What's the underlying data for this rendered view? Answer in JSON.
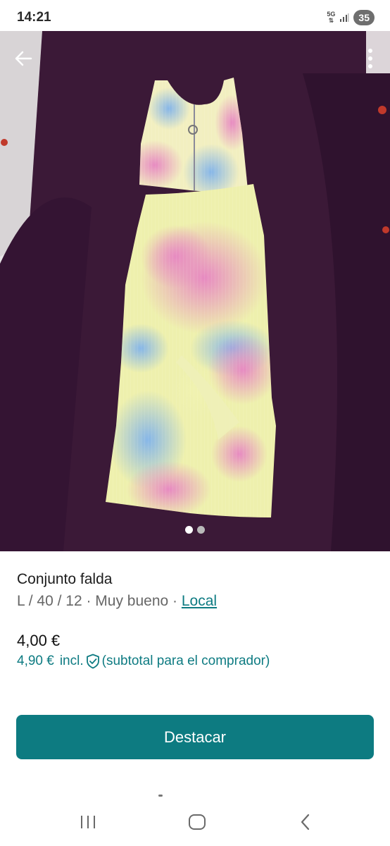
{
  "status_bar": {
    "time": "14:21",
    "network": "5G",
    "battery": "35",
    "icons": [
      "network-5g-icon",
      "signal-icon",
      "battery-icon"
    ]
  },
  "gallery": {
    "image": "tie-dye-set-photo",
    "image_count": 2,
    "active_index": 0,
    "icons": [
      "back-arrow-icon",
      "more-vertical-icon"
    ]
  },
  "item": {
    "title": "Conjunto falda",
    "size": "L / 40 / 12",
    "separator": " · ",
    "condition": "Muy bueno",
    "location_link": "Local",
    "price": "4,00 €",
    "price_total": "4,90 €",
    "incl_label": "incl.",
    "buyer_note": "(subtotal para el comprador)",
    "icons": [
      "shield-check-icon"
    ]
  },
  "actions": {
    "primary_label": "Destacar"
  },
  "nav_bar": {
    "icons": [
      "recent-apps-icon",
      "home-icon",
      "back-icon"
    ]
  },
  "colors": {
    "accent": "#0d7b81",
    "link": "#0e7b82",
    "background": "#ffffff",
    "blanket": "#3a1a38"
  }
}
